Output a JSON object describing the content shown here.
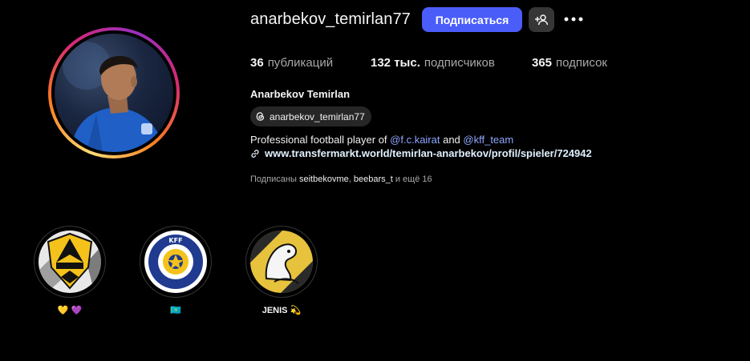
{
  "profile": {
    "username": "anarbekov_temirlan77",
    "follow_label": "Подписаться",
    "full_name": "Anarbekov Temirlan",
    "threads_handle": "anarbekov_temirlan77"
  },
  "stats": {
    "posts_count": "36",
    "posts_label": "публикаций",
    "followers_count": "132 тыс.",
    "followers_label": "подписчиков",
    "following_count": "365",
    "following_label": "подписок"
  },
  "bio": {
    "prefix": "Professional football player of ",
    "mention1": "@f.c.kairat",
    "middle": " and ",
    "mention2": "@kff_team",
    "link": "www.transfermarkt.world/temirlan-anarbekov/profil/spieler/724942"
  },
  "followed_by": {
    "prefix": "Подписаны ",
    "user1": "seitbekovme",
    "sep": ", ",
    "user2": "beebars_t",
    "suffix": " и ещё 16"
  },
  "highlights": [
    {
      "label": "💛 💜",
      "icon": "kairat-crest"
    },
    {
      "label": "🇰🇿",
      "icon": "kff-badge"
    },
    {
      "label": "JENIS 💫",
      "icon": "jenis-emblem"
    }
  ],
  "colors": {
    "follow_button": "#4a5df9",
    "mention": "#8fa6ff",
    "secondary_text": "#a8a8a8"
  }
}
